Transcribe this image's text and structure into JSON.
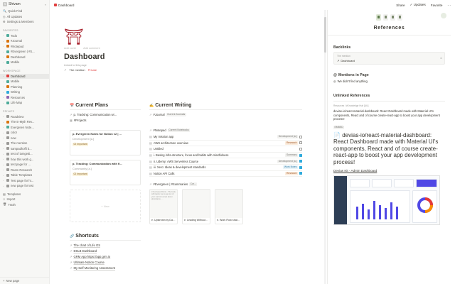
{
  "sidebar": {
    "workspace": "Shivam",
    "top_items": [
      "Quick Find",
      "All Updates",
      "Settings & Members"
    ],
    "favorites_label": "FAVORITES",
    "favorites": [
      {
        "label": "Todo",
        "color": "#4dab9a"
      },
      {
        "label": "#Journal",
        "color": "#d9730d"
      },
      {
        "label": "#Notepad",
        "color": "#d9730d"
      },
      {
        "label": "#Evergreen | #S...",
        "color": "#4dab9a"
      },
      {
        "label": "Dashboard",
        "color": "#d9730d"
      },
      {
        "label": "Mobile",
        "color": "#4dab9a"
      }
    ],
    "workspace_label": "WORKSPACE",
    "workspace_items": [
      {
        "label": "Dashboard",
        "color": "#e03e3e",
        "active": true
      },
      {
        "label": "Mobile",
        "color": "#4dab9a"
      },
      {
        "label": "Planning",
        "color": "#d9730d"
      },
      {
        "label": "Writing",
        "color": "#2eaadc"
      },
      {
        "label": "Resources",
        "color": "#9065b0"
      },
      {
        "label": "Life Map",
        "color": "#4dab9a"
      }
    ],
    "private_label": "PRIVATE",
    "private_items": [
      {
        "label": "Roadview",
        "color": "#9b9a97"
      },
      {
        "label": "The E-Myth Rev...",
        "color": "#d9730d"
      },
      {
        "label": "Evergreen Note...",
        "color": "#4dab9a"
      },
      {
        "label": "color",
        "color": "#9b9a97"
      },
      {
        "label": "new",
        "color": "#9b9a97"
      },
      {
        "label": "The mention",
        "color": "#9b9a97"
      },
      {
        "label": "sampadhoffi b...",
        "color": "#9b9a97"
      },
      {
        "label": "test of iamgetti...",
        "color": "#9b9a97"
      },
      {
        "label": "how this work g...",
        "color": "#9b9a97"
      },
      {
        "label": "test page for ...",
        "color": "#9b9a97"
      },
      {
        "label": "Roam Research",
        "color": "#9b9a97"
      },
      {
        "label": "Table Templates",
        "color": "#9b9a97"
      },
      {
        "label": "Test page for hi...",
        "color": "#9b9a97"
      },
      {
        "label": "new page for test",
        "color": "#9b9a97"
      }
    ],
    "bottom_items": [
      "Templates",
      "Import",
      "Trash"
    ],
    "new_page": "New page"
  },
  "topbar": {
    "breadcrumb": "Dashboard",
    "share": "Share",
    "updates": "Updates",
    "favorite": "Favorite",
    "more": "···"
  },
  "page": {
    "icon": "⛩",
    "add_cover": "Add cover",
    "add_comment": "Add comment",
    "title": "Dashboard",
    "linked_label": "Linked to this page",
    "mention": "The mention",
    "private": "Private"
  },
  "plans": {
    "heading": "Current Plans",
    "link": "p. Tracking: Communication wi...",
    "view": "#Projects",
    "cards": [
      {
        "title": "p. Evergreen Notes for Notion v2 | ...",
        "meta": "Development [a.]",
        "tag": "02 Important"
      },
      {
        "title": "p. Tracking: Communication with fi...",
        "meta": "Community [a.]",
        "tag": "02 Important"
      }
    ],
    "new": "+ New"
  },
  "writing": {
    "heading": "Current Writing",
    "journal_label": "#Journal",
    "journal_view": "Current Journals",
    "notepad_label": "#Notepad",
    "notepad_view": "Current Notebooks",
    "notes": [
      {
        "label": "My mission app",
        "tag": "Development [a.]",
        "tag_class": "t-gray",
        "checked": false
      },
      {
        "label": "AWS architecture overview",
        "tag": "Research",
        "tag_class": "t-orange",
        "checked": false
      },
      {
        "label": "Untitled",
        "tag": "",
        "tag_class": "",
        "checked": false
      },
      {
        "label": "i. Basing infra-structure, focus and habits with mindfulness",
        "tag": "Summary",
        "tag_class": "t-gray",
        "checked": true
      },
      {
        "label": "ii. Udemy: AWS Serverless Course",
        "tag": "Development [a.]",
        "tag_class": "t-gray",
        "checked": true
      },
      {
        "label": "iii. Xero: Ideas & development standards",
        "tag": "Work Notes",
        "tag_class": "t-blue",
        "checked": true
      },
      {
        "label": "Notion API Calls",
        "tag": "Research",
        "tag_class": "t-orange",
        "checked": true
      }
    ],
    "evergreen_label": "#Evergreen | #Summaries",
    "evergreen_view": "Cur...",
    "gallery": [
      {
        "title": "e. Upstream by Dan H...",
        "preview": "3 Overview Points - The book will inspire you to get out of your narrow tunnel; about abundance, ..."
      },
      {
        "title": "e. Leading Without Auth...",
        "preview": ""
      },
      {
        "title": "e. Work Flow strategie...",
        "preview": ""
      }
    ]
  },
  "shortcuts": {
    "heading": "Shortcuts",
    "items": [
      "The chart of Life OS",
      "DSLB Dashboard",
      "GRM App https://app.grm.io",
      "Ultimate Notion Course",
      "My Self Monitoring Assessment"
    ]
  },
  "panel": {
    "title": "References",
    "backlinks_heading": "Backlinks",
    "backlink_source": "The mention",
    "backlink_target": "Dashboard",
    "mentions_heading": "Mentions in Page",
    "mentions_text": "We didn't find anything",
    "unlinked_heading": "Unlinked References",
    "ref_meta": "Resources / #Knowledge Hub [Alt.]",
    "ref_text": "devias-io/react-material-dashboard: React Dashboard made with Material UI's components, React and of course create-react-app to boost your app development process!",
    "embed_label": "EMBED",
    "big_text": "devias-io/react-material-dashboard: React Dashboard made with Material UI's components, React and of course create-react-app to boost your app development process!",
    "link_text": "Devias Kit - Admin Dashboard"
  }
}
